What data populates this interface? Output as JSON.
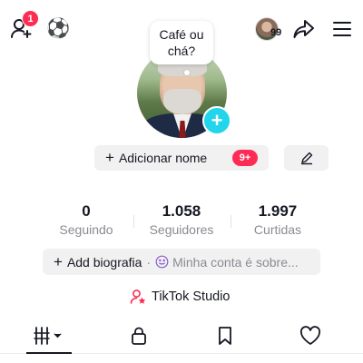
{
  "header": {
    "notification_count": "1",
    "soccer_emoji": "⚽",
    "small_avatar_count": "99",
    "icons": [
      "add-friend-icon",
      "share-icon",
      "menu-icon"
    ]
  },
  "profile": {
    "bubble_text": "Café ou chá?",
    "add_name_label": "Adicionar nome",
    "name_badge": "9+"
  },
  "stats": [
    {
      "value": "0",
      "label": "Seguindo"
    },
    {
      "value": "1.058",
      "label": "Seguidores"
    },
    {
      "value": "1.997",
      "label": "Curtidas"
    }
  ],
  "bio": {
    "add_label": "Add biografia",
    "separator": "·",
    "hint": "Minha conta é sobre..."
  },
  "studio": {
    "label": "TikTok Studio"
  },
  "tabs": [
    {
      "name": "videos",
      "icon": "grid-icon",
      "active": true
    },
    {
      "name": "private",
      "icon": "lock-icon",
      "active": false
    },
    {
      "name": "saved",
      "icon": "bookmark-icon",
      "active": false
    },
    {
      "name": "liked",
      "icon": "heart-icon",
      "active": false
    }
  ],
  "colors": {
    "accent": "#fe2c55",
    "plus_button": "#20d5ec",
    "muted_text": "#8a8b91",
    "pill_bg": "#f1f1f2"
  }
}
